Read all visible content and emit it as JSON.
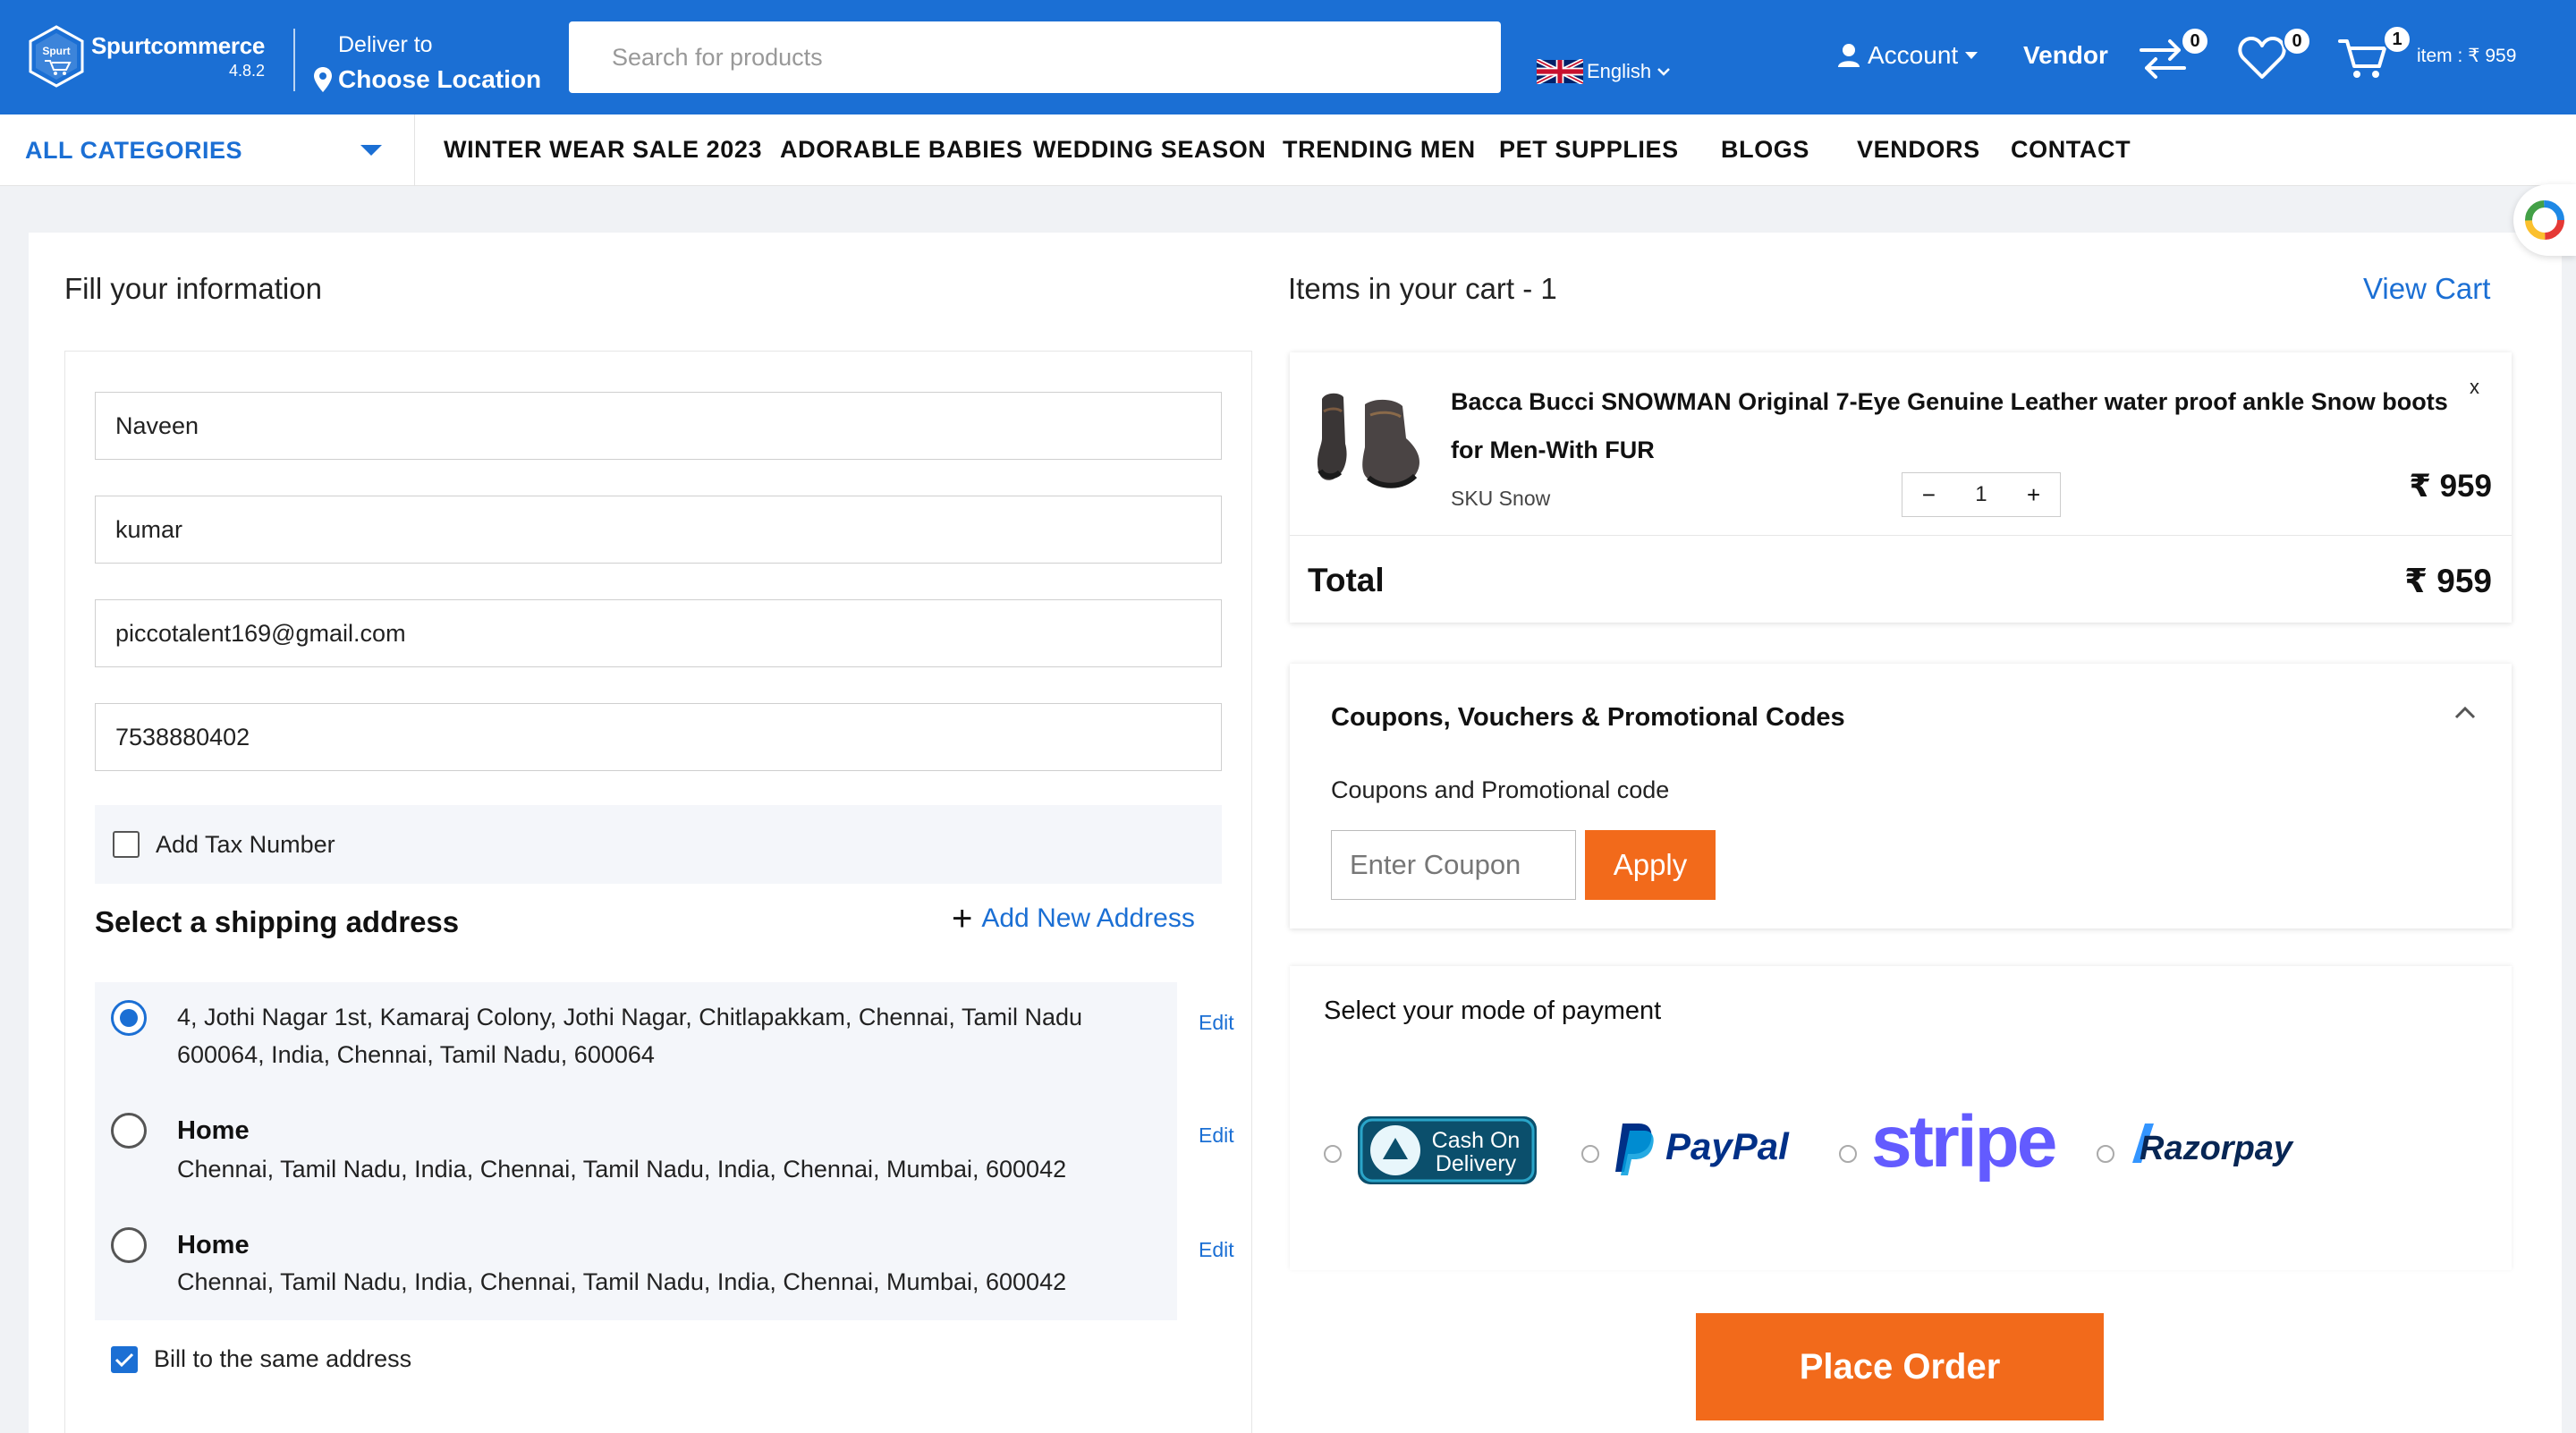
{
  "header": {
    "logo_name": "Spurtcommerce",
    "logo_badge_text": "Spurt",
    "logo_version": "4.8.2",
    "deliver_label": "Deliver to",
    "deliver_location": "Choose Location",
    "search_placeholder": "Search for products",
    "language": "English",
    "account_label": "Account",
    "vendor_label": "Vendor",
    "compare_count": "0",
    "wishlist_count": "0",
    "cart_count": "1",
    "cart_summary": "item : ₹ 959",
    "brand_color": "#1b6fd4"
  },
  "nav": {
    "all_categories": "ALL CATEGORIES",
    "items": [
      "WINTER WEAR SALE 2023",
      "ADORABLE BABIES",
      "WEDDING SEASON",
      "TRENDING MEN",
      "PET SUPPLIES",
      "BLOGS",
      "VENDORS",
      "CONTACT"
    ]
  },
  "form": {
    "title": "Fill your information",
    "first_name": "Naveen",
    "last_name": "kumar",
    "email": "piccotalent169@gmail.com",
    "phone": "7538880402",
    "tax_label": "Add Tax Number",
    "tax_checked": false,
    "shipping_title": "Select a shipping address",
    "add_address": "Add New Address",
    "addresses": [
      {
        "name": "",
        "line1": "4, Jothi Nagar 1st, Kamaraj Colony, Jothi Nagar, Chitlapakkam, Chennai, Tamil Nadu",
        "line2": "600064, India, Chennai, Tamil Nadu, 600064",
        "edit": "Edit",
        "selected": true
      },
      {
        "name": "Home",
        "line1": "Chennai, Tamil Nadu, India, Chennai, Tamil Nadu, India, Chennai, Mumbai, 600042",
        "line2": "",
        "edit": "Edit",
        "selected": false
      },
      {
        "name": "Home",
        "line1": "Chennai, Tamil Nadu, India, Chennai, Tamil Nadu, India, Chennai, Mumbai, 600042",
        "line2": "",
        "edit": "Edit",
        "selected": false
      }
    ],
    "bill_same": "Bill to the same address",
    "bill_checked": true
  },
  "cart": {
    "title": "Items in your cart - 1",
    "view_cart": "View Cart",
    "product_name": "Bacca Bucci SNOWMAN Original 7-Eye Genuine Leather water proof ankle Snow boots for Men-With FUR",
    "remove": "x",
    "sku": "SKU Snow",
    "qty_minus": "−",
    "qty": "1",
    "qty_plus": "+",
    "price": "₹ 959",
    "total_label": "Total",
    "total_value": "₹ 959"
  },
  "coupon": {
    "title": "Coupons, Vouchers & Promotional Codes",
    "sub": "Coupons and Promotional code",
    "placeholder": "Enter Coupon",
    "apply": "Apply",
    "accent": "#f26a1b"
  },
  "payment": {
    "title": "Select your mode of payment",
    "methods": [
      {
        "name": "Cash On Delivery",
        "line1": "Cash On",
        "line2": "Delivery"
      },
      {
        "name": "PayPal"
      },
      {
        "name": "stripe"
      },
      {
        "name": "Razorpay"
      }
    ],
    "place_order": "Place Order"
  }
}
